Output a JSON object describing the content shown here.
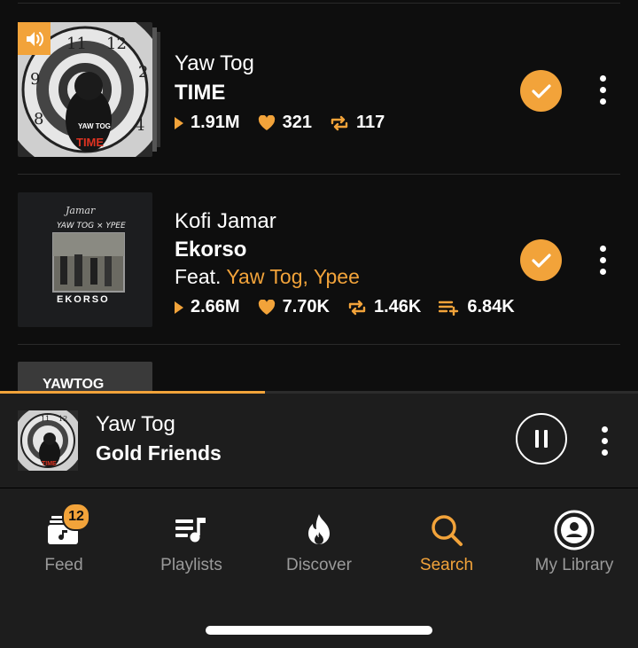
{
  "tracks": [
    {
      "artist": "Yaw Tog",
      "title": "TIME",
      "feat_prefix": "",
      "feat_artists": "",
      "plays": "1.91M",
      "likes": "321",
      "reposts": "117",
      "playlist_adds": "",
      "cover_text_top": "YAW TOG",
      "cover_text_bottom": "TIME",
      "now_playing": true,
      "checked": true
    },
    {
      "artist": "Kofi Jamar",
      "title": "Ekorso",
      "feat_prefix": "Feat.",
      "feat_artists": "Yaw Tog, Ypee",
      "plays": "2.66M",
      "likes": "7.70K",
      "reposts": "1.46K",
      "playlist_adds": "6.84K",
      "cover_text_top": "YAW TOG × YPEE",
      "cover_text_bottom": "EKORSO",
      "now_playing": false,
      "checked": true
    },
    {
      "cover_text_top": "YAWTOG"
    }
  ],
  "player": {
    "artist": "Yaw Tog",
    "title": "Gold Friends",
    "progress": 0.415,
    "cover_text": "TIME"
  },
  "tabs": [
    {
      "label": "Feed",
      "icon": "feed-icon",
      "badge": "12"
    },
    {
      "label": "Playlists",
      "icon": "playlists-icon"
    },
    {
      "label": "Discover",
      "icon": "discover-fire-icon"
    },
    {
      "label": "Search",
      "icon": "search-icon",
      "active": true
    },
    {
      "label": "My Library",
      "icon": "my-library-icon"
    }
  ],
  "colors": {
    "accent": "#f2a33a",
    "background": "#0e0e0e",
    "bar": "#1d1d1d",
    "muted": "#9a9a9a"
  }
}
